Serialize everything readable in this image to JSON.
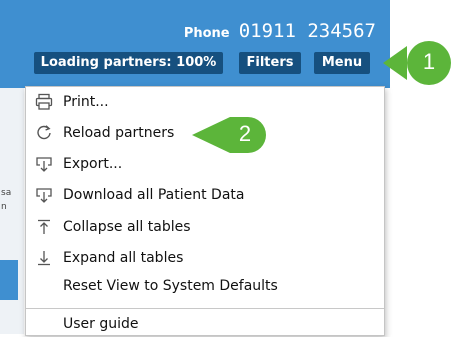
{
  "header": {
    "phone_label": "Phone",
    "phone_number": "01911 234567",
    "buttons": {
      "loading": "Loading partners: 100%",
      "filters": "Filters",
      "menu": "Menu"
    }
  },
  "menu": {
    "items": [
      {
        "label": "Print...",
        "icon": "printer-icon"
      },
      {
        "label": "Reload partners",
        "icon": "reload-icon"
      },
      {
        "label": "Export...",
        "icon": "export-icon"
      },
      {
        "label": "Download all Patient Data",
        "icon": "download-icon"
      },
      {
        "label": "Collapse all tables",
        "icon": "collapse-icon"
      },
      {
        "label": "Expand all tables",
        "icon": "expand-icon"
      },
      {
        "label": "Reset View to System Defaults",
        "icon": ""
      },
      {
        "label": "User guide",
        "icon": ""
      }
    ]
  },
  "callouts": [
    "1",
    "2"
  ],
  "colors": {
    "header": "#3f8fd0",
    "button": "#16507f",
    "callout": "#5cb53a"
  }
}
